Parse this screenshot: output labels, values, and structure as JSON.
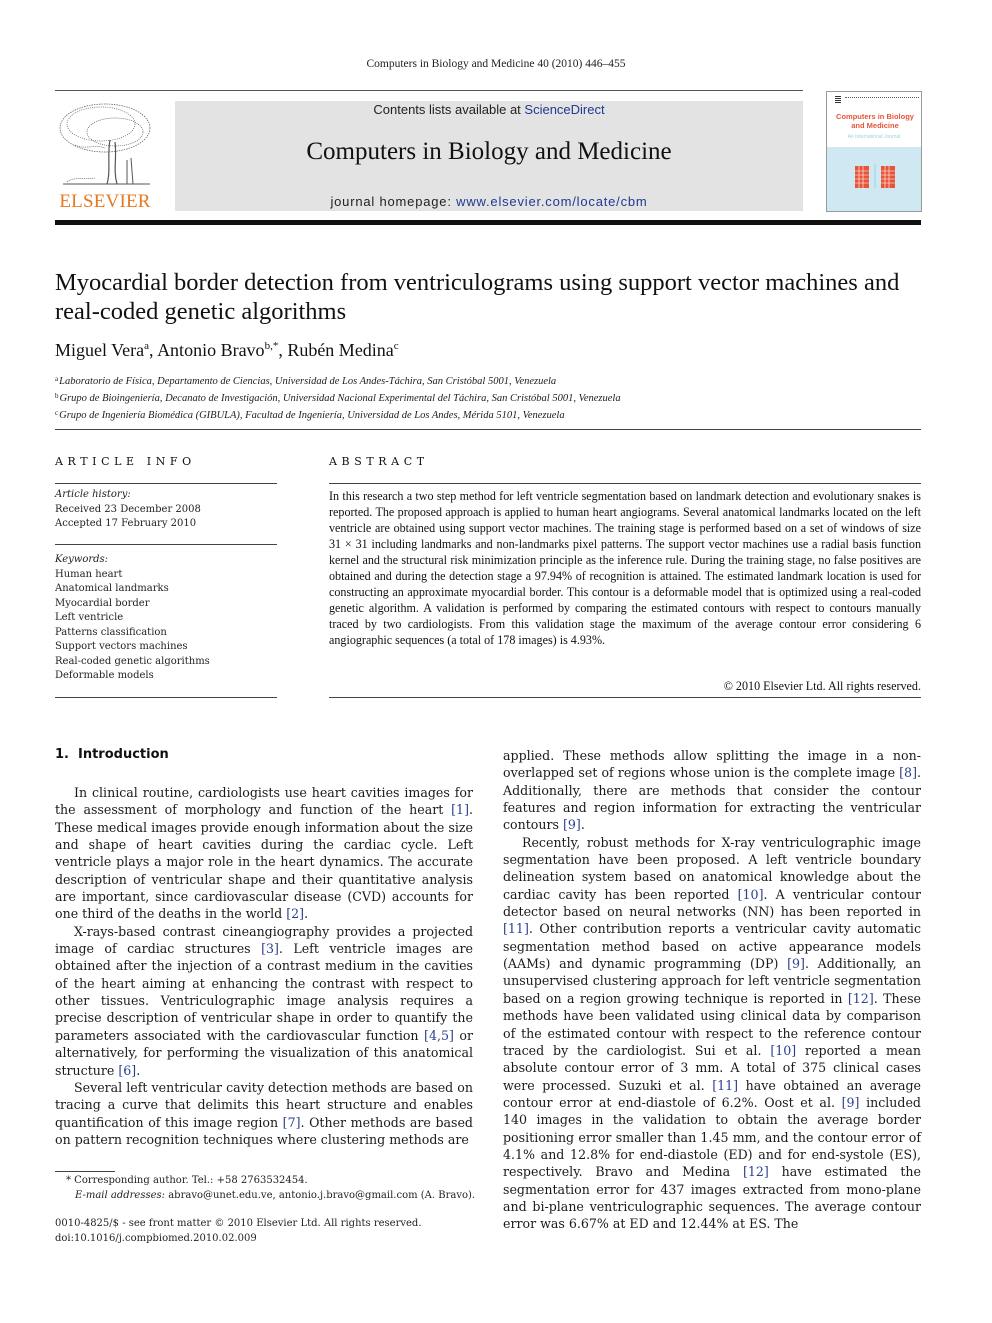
{
  "running_head": "Computers in Biology and Medicine 40 (2010) 446–455",
  "masthead": {
    "publisher_wordmark": "ELSEVIER",
    "contents_prefix": "Contents lists available at ",
    "contents_link": "ScienceDirect",
    "journal_title": "Computers in Biology and Medicine",
    "homepage_prefix": "journal homepage: ",
    "homepage_link": "www.elsevier.com/locate/cbm",
    "cover": {
      "title_line1": "Computers in Biology",
      "title_line2": "and Medicine",
      "subtitle": "An International Journal"
    },
    "colors": {
      "elsevier_orange": "#e8771e",
      "masthead_gray": "#e3e3e3",
      "link_blue": "#1f3a93",
      "cover_red": "#e8543a",
      "cover_blue": "#cfe8f2"
    }
  },
  "article": {
    "title": "Myocardial border detection from ventriculograms using support vector machines and real-coded genetic algorithms",
    "authors": [
      {
        "name": "Miguel Vera",
        "sup": "a"
      },
      {
        "name": "Antonio Bravo",
        "sup": "b,*"
      },
      {
        "name": "Rubén Medina",
        "sup": "c"
      }
    ],
    "affiliations": [
      {
        "sup": "a",
        "text": "Laboratorio de Física, Departamento de Ciencias, Universidad de Los Andes-Táchira, San Cristóbal 5001, Venezuela"
      },
      {
        "sup": "b",
        "text": "Grupo de Bioingeniería, Decanato de Investigación, Universidad Nacional Experimental del Táchira, San Cristóbal 5001, Venezuela"
      },
      {
        "sup": "c",
        "text": "Grupo de Ingeniería Biomédica (GIBULA), Facultad de Ingeniería, Universidad de Los Andes, Mérida 5101, Venezuela"
      }
    ]
  },
  "article_info": {
    "heading": "ARTICLE INFO",
    "history_label": "Article history:",
    "received": "Received 23 December 2008",
    "accepted": "Accepted 17 February 2010",
    "keywords_label": "Keywords:",
    "keywords": [
      "Human heart",
      "Anatomical landmarks",
      "Myocardial border",
      "Left ventricle",
      "Patterns classification",
      "Support vectors machines",
      "Real-coded genetic algorithms",
      "Deformable models"
    ]
  },
  "abstract": {
    "heading": "ABSTRACT",
    "text": "In this research a two step method for left ventricle segmentation based on landmark detection and evolutionary snakes is reported. The proposed approach is applied to human heart angiograms. Several anatomical landmarks located on the left ventricle are obtained using support vector machines. The training stage is performed based on a set of windows of size 31 × 31 including landmarks and non-landmarks pixel patterns. The support vector machines use a radial basis function kernel and the structural risk minimization principle as the inference rule. During the training stage, no false positives are obtained and during the detection stage a 97.94% of recognition is attained. The estimated landmark location is used for constructing an approximate myocardial border. This contour is a deformable model that is optimized using a real-coded genetic algorithm. A validation is performed by comparing the estimated contours with respect to contours manually traced by two cardiologists. From this validation stage the maximum of the average contour error considering 6 angiographic sequences (a total of 178 images) is 4.93%.",
    "copyright": "© 2010 Elsevier Ltd. All rights reserved."
  },
  "introduction": {
    "number": "1.",
    "heading": "Introduction",
    "left_paragraphs": [
      [
        {
          "t": "In clinical routine, cardiologists use heart cavities images for the assessment of morphology and function of the heart "
        },
        {
          "c": "[1]"
        },
        {
          "t": ". These medical images provide enough information about the size and shape of heart cavities during the cardiac cycle. Left ventricle plays a major role in the heart dynamics. The accurate description of ventricular shape and their quantitative analysis are important, since cardiovascular disease (CVD) accounts for one third of the deaths in the world "
        },
        {
          "c": "[2]"
        },
        {
          "t": "."
        }
      ],
      [
        {
          "t": "X-rays-based contrast cineangiography provides a projected image of cardiac structures "
        },
        {
          "c": "[3]"
        },
        {
          "t": ". Left ventricle images are obtained after the injection of a contrast medium in the cavities of the heart aiming at enhancing the contrast with respect to other tissues. Ventriculographic image analysis requires a precise description of ventricular shape in order to quantify the parameters associated with the cardiovascular function "
        },
        {
          "c": "[4,5]"
        },
        {
          "t": " or alternatively, for performing the visualization of this anatomical structure "
        },
        {
          "c": "[6]"
        },
        {
          "t": "."
        }
      ],
      [
        {
          "t": "Several left ventricular cavity detection methods are based on tracing a curve that delimits this heart structure and enables quantification of this image region "
        },
        {
          "c": "[7]"
        },
        {
          "t": ". Other methods are based on pattern recognition techniques where clustering methods are"
        }
      ]
    ],
    "right_paragraphs": [
      [
        {
          "t": "applied. These methods allow splitting the image in a non-overlapped set of regions whose union is the complete image "
        },
        {
          "c": "[8]"
        },
        {
          "t": ". Additionally, there are methods that consider the contour features and region information for extracting the ventricular contours "
        },
        {
          "c": "[9]"
        },
        {
          "t": "."
        }
      ],
      [
        {
          "t": "Recently, robust methods for X-ray ventriculographic image segmentation have been proposed. A left ventricle boundary delineation system based on anatomical knowledge about the cardiac cavity has been reported "
        },
        {
          "c": "[10]"
        },
        {
          "t": ". A ventricular contour detector based on neural networks (NN) has been reported in "
        },
        {
          "c": "[11]"
        },
        {
          "t": ". Other contribution reports a ventricular cavity automatic segmentation method based on active appearance models (AAMs) and dynamic programming (DP) "
        },
        {
          "c": "[9]"
        },
        {
          "t": ". Additionally, an unsupervised clustering approach for left ventricle segmentation based on a region growing technique is reported in "
        },
        {
          "c": "[12]"
        },
        {
          "t": ". These methods have been validated using clinical data by comparison of the estimated contour with respect to the reference contour traced by the cardiologist. Sui et al. "
        },
        {
          "c": "[10]"
        },
        {
          "t": " reported a mean absolute contour error of 3 mm. A total of 375 clinical cases were processed. Suzuki et al. "
        },
        {
          "c": "[11]"
        },
        {
          "t": " have obtained an average contour error at end-diastole of 6.2%. Oost et al. "
        },
        {
          "c": "[9]"
        },
        {
          "t": " included 140 images in the validation to obtain the average border positioning error smaller than 1.45 mm, and the contour error of 4.1% and 12.8% for end-diastole (ED) and for end-systole (ES), respectively. Bravo and Medina "
        },
        {
          "c": "[12]"
        },
        {
          "t": " have estimated the segmentation error for 437 images extracted from mono-plane and bi-plane ventriculographic sequences. The average contour error was 6.67% at ED and 12.44% at ES. The"
        }
      ]
    ]
  },
  "footnote": {
    "corresponding": "* Corresponding author. Tel.: +58 2763532454.",
    "email_label": "E-mail addresses:",
    "emails": " abravo@unet.edu.ve, antonio.j.bravo@gmail.com (A. Bravo)."
  },
  "front_matter": {
    "issn_line": "0010-4825/$ - see front matter © 2010 Elsevier Ltd. All rights reserved.",
    "doi": "doi:10.1016/j.compbiomed.2010.02.009"
  }
}
